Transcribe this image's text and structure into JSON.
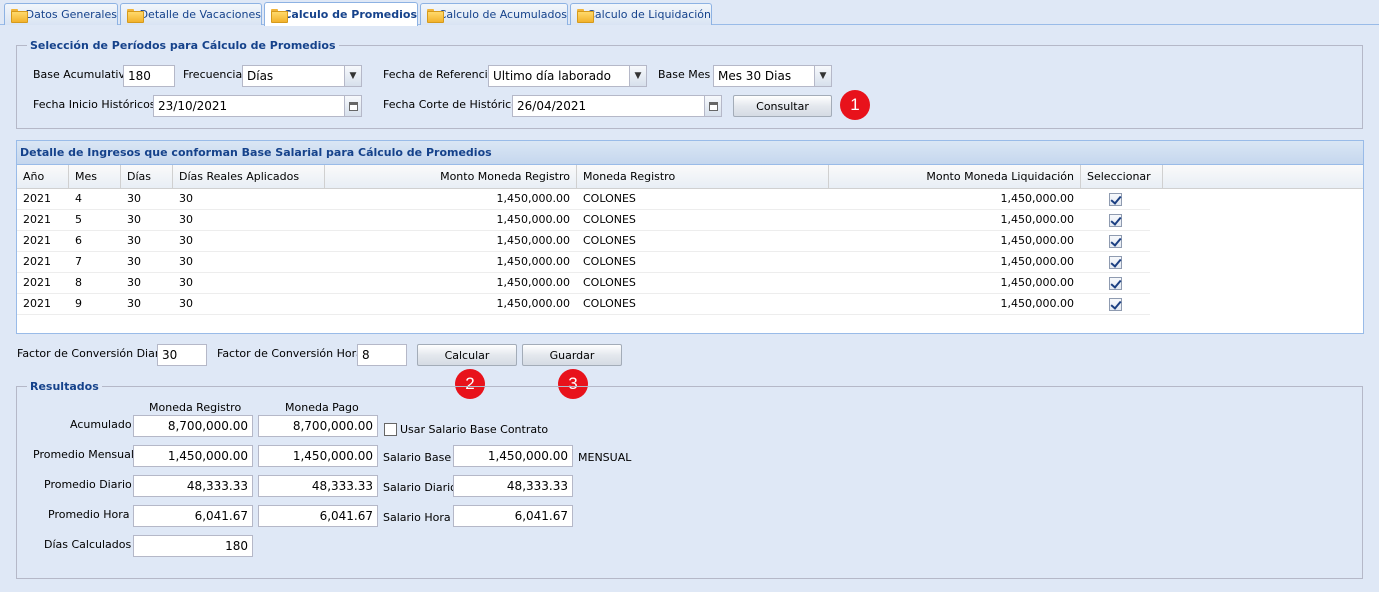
{
  "tabs": [
    {
      "label": "Datos Generales"
    },
    {
      "label": "Detalle de Vacaciones"
    },
    {
      "label": "Calculo de Promedios"
    },
    {
      "label": "Calculo de Acumulados"
    },
    {
      "label": "Calculo de Liquidación"
    }
  ],
  "periodos": {
    "legend": "Selección de Períodos para Cálculo de Promedios",
    "base_acumulativa_label": "Base Acumulativa",
    "base_acumulativa": "180",
    "frecuencia_label": "Frecuencia",
    "frecuencia": "Días",
    "fecha_referencia_label": "Fecha de Referencia",
    "fecha_referencia": "Ultimo día laborado",
    "base_mes_label": "Base Mes",
    "base_mes": "Mes 30 Dias",
    "fecha_inicio_label": "Fecha Inicio Históricos",
    "fecha_inicio": "23/10/2021",
    "fecha_corte_label": "Fecha Corte de Históricos",
    "fecha_corte": "26/04/2021",
    "consultar": "Consultar"
  },
  "grid": {
    "title": "Detalle de Ingresos que conforman Base Salarial para Cálculo de Promedios",
    "columns": [
      "Año",
      "Mes",
      "Días",
      "Días Reales Aplicados",
      "Monto Moneda Registro",
      "Moneda Registro",
      "Monto Moneda Liquidación",
      "Seleccionar"
    ],
    "rows": [
      [
        "2021",
        "4",
        "30",
        "30",
        "1,450,000.00",
        "COLONES",
        "1,450,000.00"
      ],
      [
        "2021",
        "5",
        "30",
        "30",
        "1,450,000.00",
        "COLONES",
        "1,450,000.00"
      ],
      [
        "2021",
        "6",
        "30",
        "30",
        "1,450,000.00",
        "COLONES",
        "1,450,000.00"
      ],
      [
        "2021",
        "7",
        "30",
        "30",
        "1,450,000.00",
        "COLONES",
        "1,450,000.00"
      ],
      [
        "2021",
        "8",
        "30",
        "30",
        "1,450,000.00",
        "COLONES",
        "1,450,000.00"
      ],
      [
        "2021",
        "9",
        "30",
        "30",
        "1,450,000.00",
        "COLONES",
        "1,450,000.00"
      ]
    ],
    "selected": [
      true,
      true,
      true,
      true,
      true,
      true
    ]
  },
  "factores": {
    "diario_label": "Factor de Conversión Diario",
    "diario": "30",
    "hora_label": "Factor de Conversión Hora",
    "hora": "8",
    "calcular": "Calcular",
    "guardar": "Guardar"
  },
  "markers": [
    "1",
    "2",
    "3"
  ],
  "resultados": {
    "legend": "Resultados",
    "col_registro": "Moneda Registro",
    "col_pago": "Moneda Pago",
    "acumulado_label": "Acumulado",
    "acumulado_registro": "8,700,000.00",
    "acumulado_pago": "8,700,000.00",
    "usar_salario_label": "Usar Salario Base Contrato",
    "usar_salario_checked": false,
    "mensual_label": "Promedio Mensual",
    "mensual_registro": "1,450,000.00",
    "mensual_pago": "1,450,000.00",
    "salario_base_label": "Salario Base",
    "salario_base": "1,450,000.00",
    "salario_base_unit": "MENSUAL",
    "diario_label": "Promedio Diario",
    "diario_registro": "48,333.33",
    "diario_pago": "48,333.33",
    "salario_diario_label": "Salario Diario",
    "salario_diario": "48,333.33",
    "hora_label": "Promedio Hora",
    "hora_registro": "6,041.67",
    "hora_pago": "6,041.67",
    "salario_hora_label": "Salario Hora",
    "salario_hora": "6,041.67",
    "dias_label": "Días Calculados",
    "dias": "180"
  }
}
